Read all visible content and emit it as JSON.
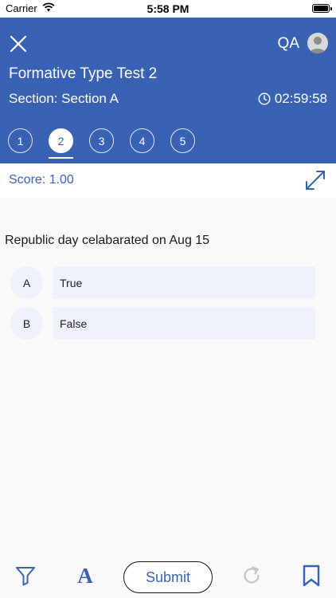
{
  "status_bar": {
    "carrier": "Carrier",
    "time": "5:58 PM"
  },
  "header": {
    "user": "QA",
    "test_title": "Formative Type Test 2",
    "section": "Section: Section A",
    "timer": "02:59:58",
    "questions": [
      "1",
      "2",
      "3",
      "4",
      "5"
    ],
    "active_question": 2
  },
  "score": {
    "label": "Score: 1.00"
  },
  "question": {
    "text": "Republic day celabarated on Aug 15",
    "options": [
      {
        "letter": "A",
        "text": "True"
      },
      {
        "letter": "B",
        "text": "False"
      }
    ]
  },
  "toolbar": {
    "submit_label": "Submit",
    "font_icon_glyph": "A"
  },
  "colors": {
    "header_bg": "#3a62b4",
    "accent": "#3a62b4",
    "option_bg": "#eef0fa",
    "page_bg": "#f9f9f9"
  }
}
